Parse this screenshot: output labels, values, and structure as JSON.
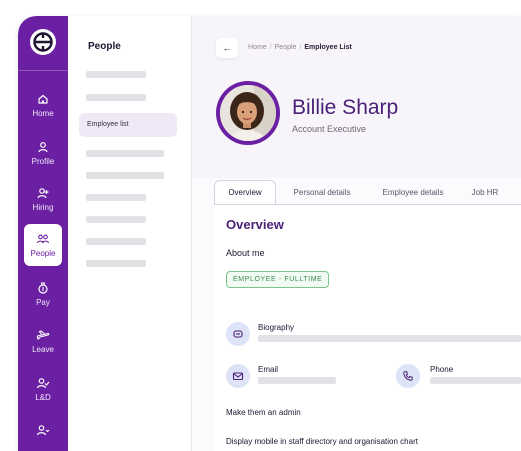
{
  "nav": {
    "items": [
      {
        "label": "Home",
        "icon": "home-icon"
      },
      {
        "label": "Profile",
        "icon": "profile-icon"
      },
      {
        "label": "Hiring",
        "icon": "hiring-icon"
      },
      {
        "label": "People",
        "icon": "people-icon",
        "active": true
      },
      {
        "label": "Pay",
        "icon": "pay-icon"
      },
      {
        "label": "Leave",
        "icon": "leave-icon"
      },
      {
        "label": "L&D",
        "icon": "learning-icon"
      },
      {
        "label": "",
        "icon": "user-more-icon"
      }
    ]
  },
  "subnav": {
    "title": "People",
    "active_item": "Employee list"
  },
  "breadcrumb": {
    "items": [
      "Home",
      "People",
      "Employee List"
    ],
    "separator": "/"
  },
  "profile": {
    "name": "Billie Sharp",
    "role": "Account Executive"
  },
  "tabs": [
    "Overview",
    "Personal details",
    "Employee details",
    "Job HR"
  ],
  "overview": {
    "title": "Overview",
    "about_heading": "About me",
    "employment_badge": "EMPLOYEE - FULLTIME",
    "biography_label": "Biography",
    "email_label": "Email",
    "phone_label": "Phone",
    "admin_text": "Make them an admin",
    "display_mobile_text": "Display mobile in staff directory and organisation chart"
  },
  "colors": {
    "brand_purple": "#6b1fa3",
    "heading_purple": "#4b2177",
    "badge_green": "#3c8d52",
    "icon_circle_blue": "#dde4f7"
  }
}
